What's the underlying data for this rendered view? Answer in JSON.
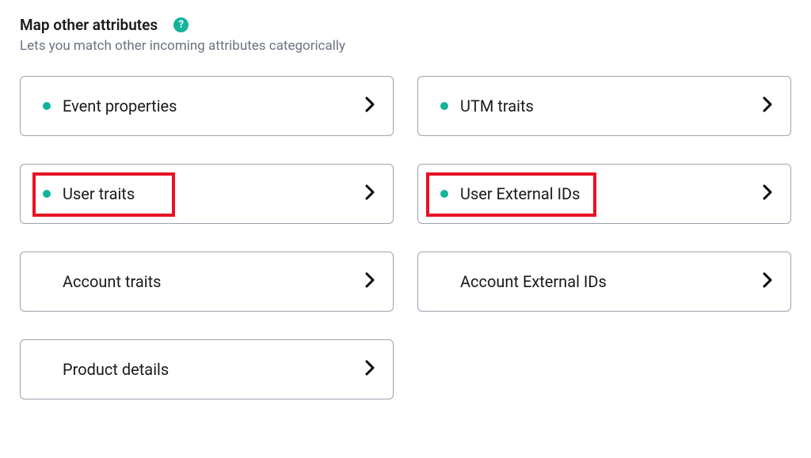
{
  "header": {
    "title": "Map other attributes",
    "subtitle": "Lets you match other incoming attributes categorically",
    "help_symbol": "?"
  },
  "cards": [
    {
      "id": "event-properties",
      "label": "Event properties",
      "has_dot": true,
      "highlighted": false
    },
    {
      "id": "utm-traits",
      "label": "UTM traits",
      "has_dot": true,
      "highlighted": false
    },
    {
      "id": "user-traits",
      "label": "User traits",
      "has_dot": true,
      "highlighted": true,
      "highlight_class": "highlight-1"
    },
    {
      "id": "user-external-ids",
      "label": "User External IDs",
      "has_dot": true,
      "highlighted": true,
      "highlight_class": "highlight-2"
    },
    {
      "id": "account-traits",
      "label": "Account traits",
      "has_dot": false,
      "highlighted": false
    },
    {
      "id": "account-external-ids",
      "label": "Account External IDs",
      "has_dot": false,
      "highlighted": false
    },
    {
      "id": "product-details",
      "label": "Product details",
      "has_dot": false,
      "highlighted": false
    }
  ],
  "colors": {
    "accent": "#14b39b",
    "highlight": "#e81123",
    "border": "#9ca3af",
    "text": "#1a1a1a",
    "subtext": "#6b7280"
  }
}
